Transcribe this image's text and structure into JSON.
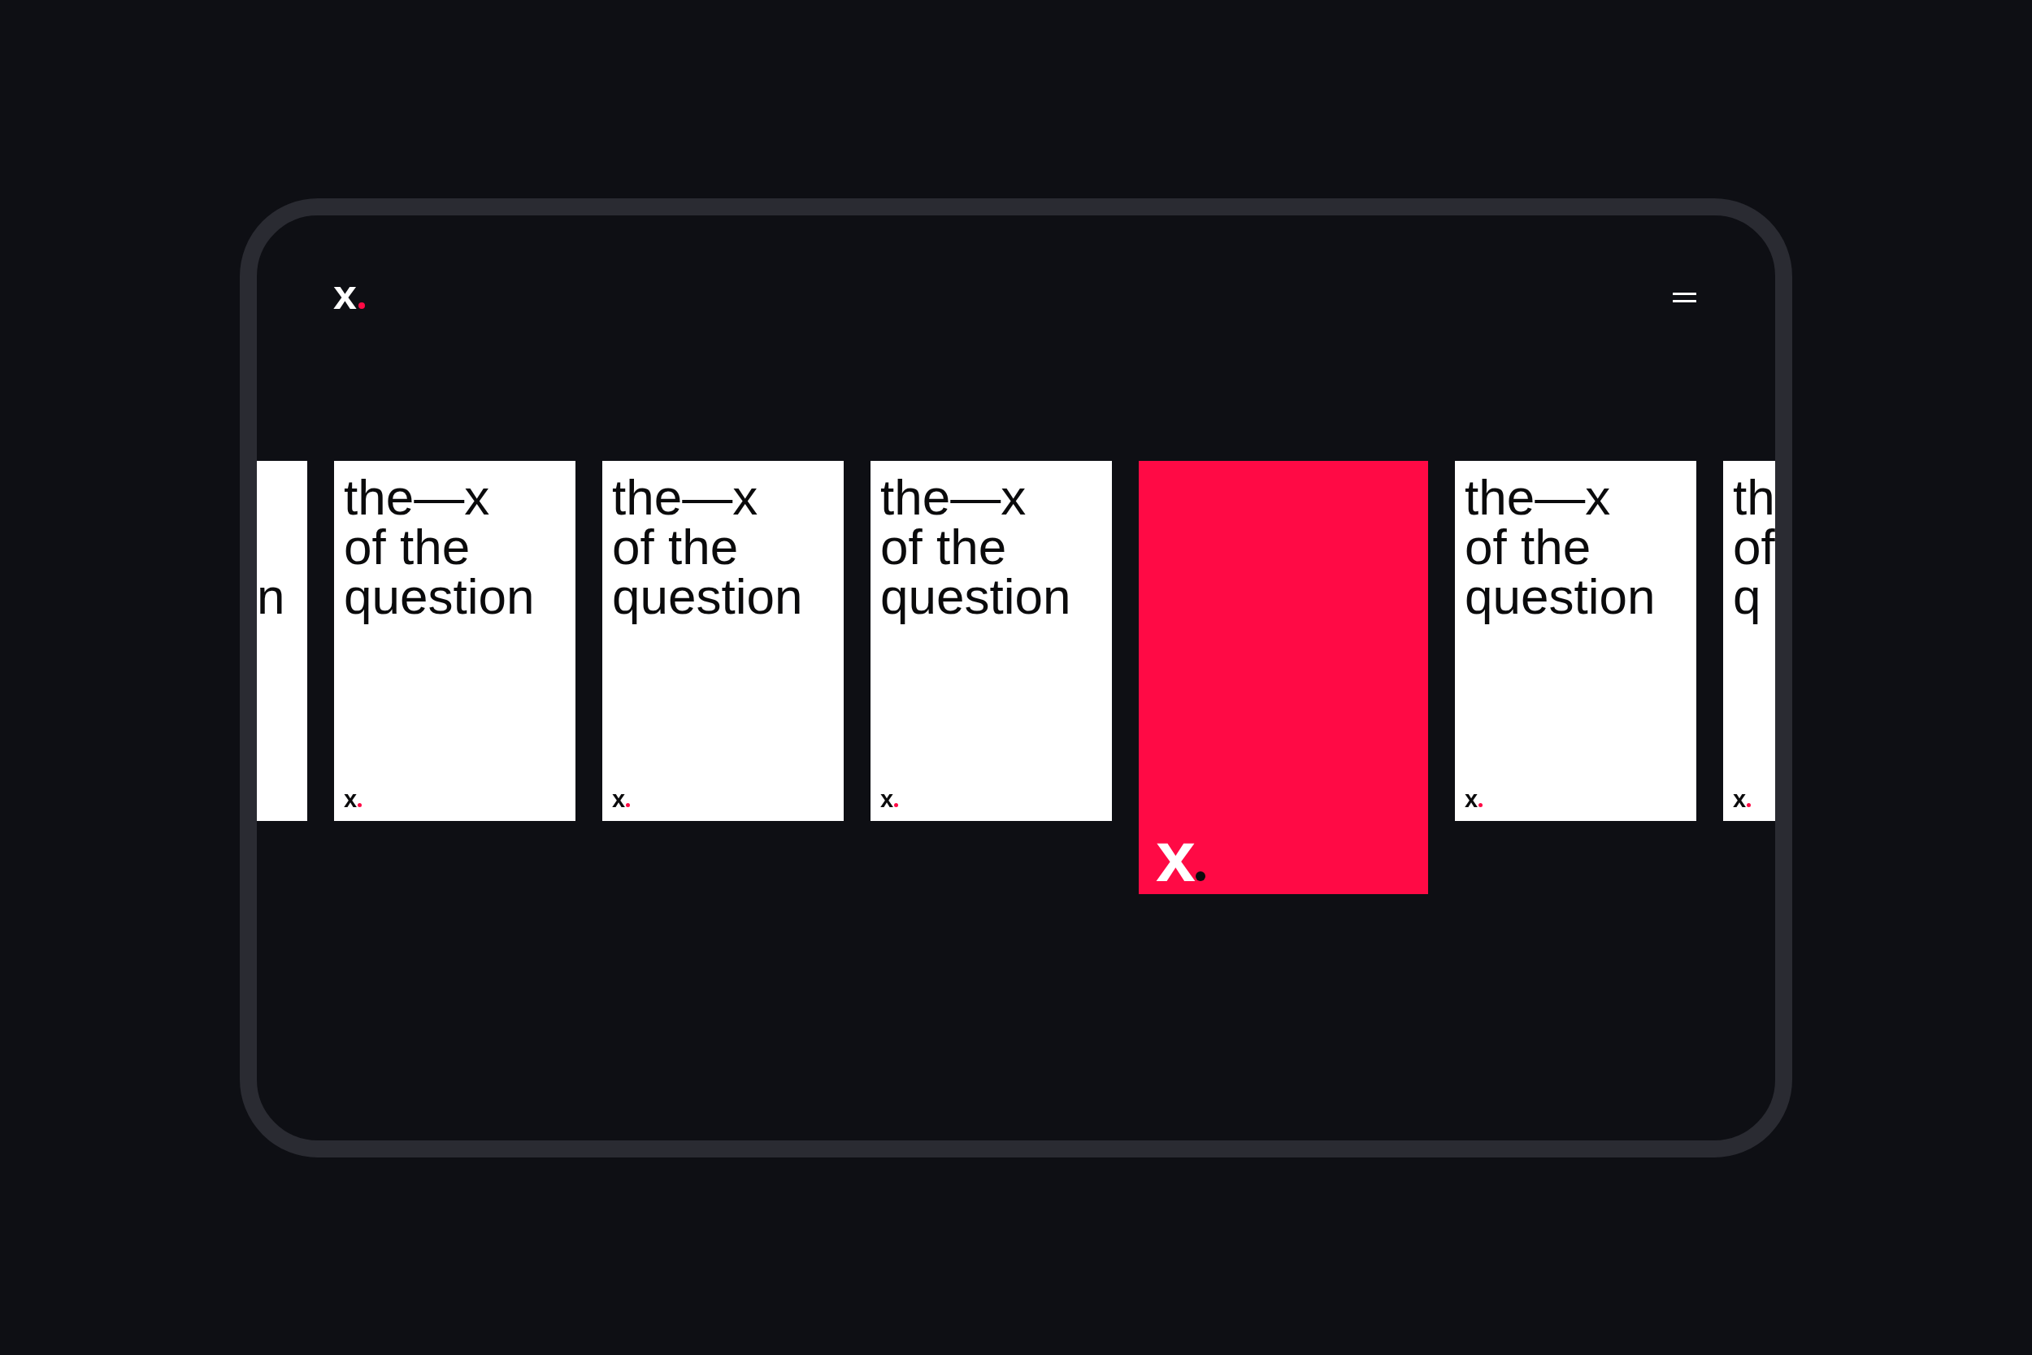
{
  "header": {
    "logo": "x"
  },
  "cards": [
    {
      "kind": "poster",
      "bottom_line": "n"
    },
    {
      "kind": "poster",
      "top_line": "the—x",
      "middle_line": "of the",
      "bottom_line": "question",
      "logo": "x"
    },
    {
      "kind": "poster",
      "top_line": "the—x",
      "middle_line": "of the",
      "bottom_line": "question",
      "logo": "x"
    },
    {
      "kind": "poster",
      "top_line": "the—x",
      "middle_line": "of the",
      "bottom_line": "question",
      "logo": "x"
    },
    {
      "kind": "cover",
      "logo": "x"
    },
    {
      "kind": "poster",
      "top_line": "the—x",
      "middle_line": "of the",
      "bottom_line": "question",
      "logo": "x"
    },
    {
      "kind": "poster",
      "top_line": "th",
      "middle_line": "of",
      "bottom_line": "q",
      "logo": "x"
    }
  ]
}
